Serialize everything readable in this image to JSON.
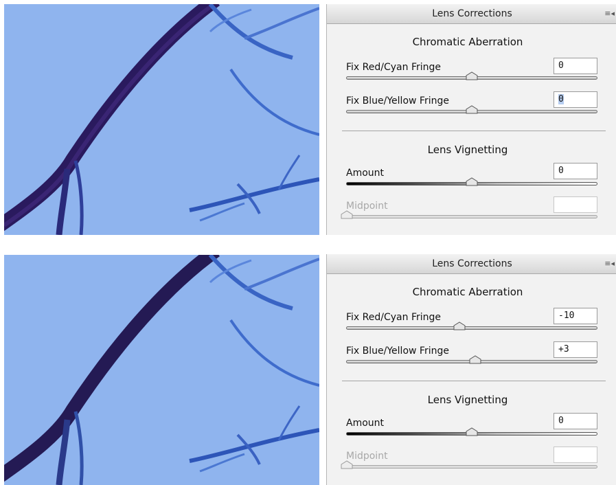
{
  "panels": [
    {
      "header": "Lens Corrections",
      "menu_icon": "panel-menu-icon",
      "chromatic": {
        "title": "Chromatic Aberration",
        "red_cyan": {
          "label": "Fix Red/Cyan Fringe",
          "value": "0",
          "position": 0.5
        },
        "blue_yellow": {
          "label": "Fix Blue/Yellow Fringe",
          "value": "0",
          "position": 0.5
        }
      },
      "vignetting": {
        "title": "Lens Vignetting",
        "amount": {
          "label": "Amount",
          "value": "0",
          "position": 0.5
        },
        "midpoint": {
          "label": "Midpoint",
          "value": "",
          "position": 0.0
        }
      }
    },
    {
      "header": "Lens Corrections",
      "menu_icon": "panel-menu-icon",
      "chromatic": {
        "title": "Chromatic Aberration",
        "red_cyan": {
          "label": "Fix Red/Cyan Fringe",
          "value": "-10",
          "position": 0.45
        },
        "blue_yellow": {
          "label": "Fix Blue/Yellow Fringe",
          "value": "+3",
          "position": 0.515
        }
      },
      "vignetting": {
        "title": "Lens Vignetting",
        "amount": {
          "label": "Amount",
          "value": "0",
          "position": 0.5
        },
        "midpoint": {
          "label": "Midpoint",
          "value": "",
          "position": 0.0
        }
      }
    }
  ],
  "colors": {
    "sky": "#8fb4ee",
    "branch_dark": "#2a1a5e",
    "branch_blue": "#2d55b8",
    "selection_highlight": "#b6cdf0"
  }
}
